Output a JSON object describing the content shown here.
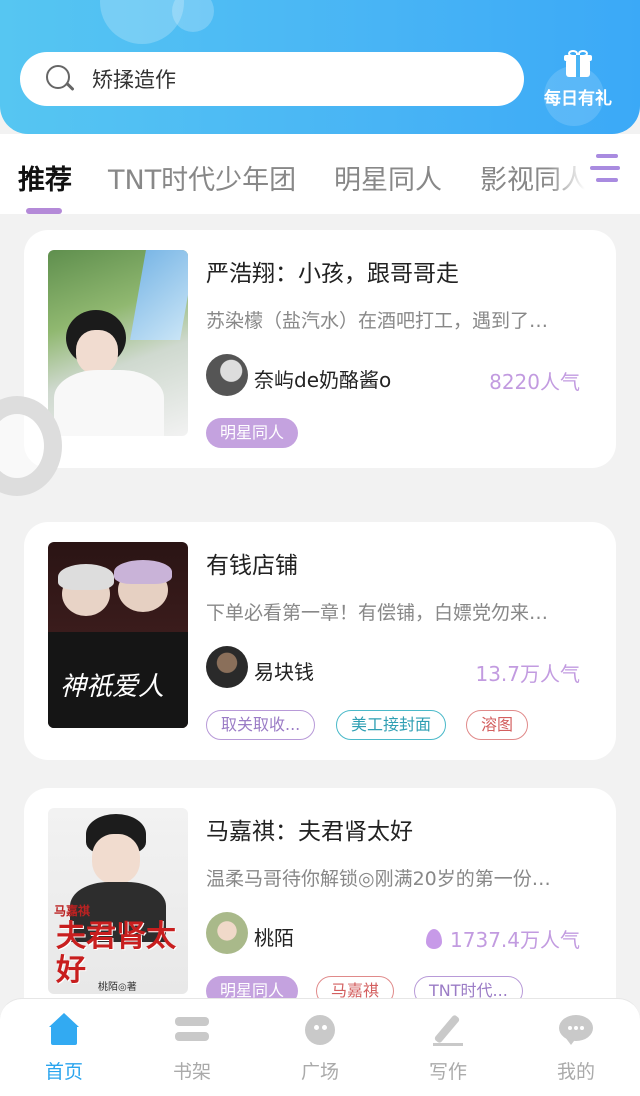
{
  "search": {
    "placeholder_text": "矫揉造作"
  },
  "gift": {
    "label": "每日有礼"
  },
  "tabs": [
    {
      "label": "推荐",
      "active": true
    },
    {
      "label": "TNT时代少年团",
      "active": false
    },
    {
      "label": "明星同人",
      "active": false
    },
    {
      "label": "影视同人",
      "active": false
    }
  ],
  "cards": [
    {
      "title": "严浩翔：小孩，跟哥哥走",
      "description": "苏染檬（盐汽水）在酒吧打工，遇到了…",
      "author": "奈屿de奶酪酱o",
      "popularity": "8220人气",
      "tags": [
        "明星同人"
      ]
    },
    {
      "title": "有钱店铺",
      "description": "下单必看第一章！有偿铺，白嫖党勿来…",
      "author": "易块钱",
      "popularity": "13.7万人气",
      "cover_text": "神祇爱人",
      "tags": [
        "取关取收...",
        "美工接封面",
        "溶图"
      ]
    },
    {
      "title": "马嘉祺：夫君肾太好",
      "description": "温柔马哥待你解锁◎刚满20岁的第一份…",
      "author": "桃陌",
      "popularity": "1737.4万人气",
      "cover_text_top": "马嘉祺",
      "cover_text_main": "夫君肾太好",
      "cover_author": "桃陌◎著",
      "tags": [
        "明星同人",
        "马嘉祺",
        "TNT时代..."
      ]
    }
  ],
  "bottom_nav": [
    {
      "label": "首页",
      "icon": "home-icon",
      "active": true
    },
    {
      "label": "书架",
      "icon": "bookshelf-icon",
      "active": false
    },
    {
      "label": "广场",
      "icon": "plaza-icon",
      "active": false
    },
    {
      "label": "写作",
      "icon": "write-icon",
      "active": false
    },
    {
      "label": "我的",
      "icon": "profile-icon",
      "active": false
    }
  ],
  "colors": {
    "header_gradient_start": "#56c6f2",
    "header_gradient_end": "#3ba9f7",
    "accent_purple": "#b48ad8",
    "nav_active": "#2ba5ee",
    "popularity": "#c29be0"
  }
}
